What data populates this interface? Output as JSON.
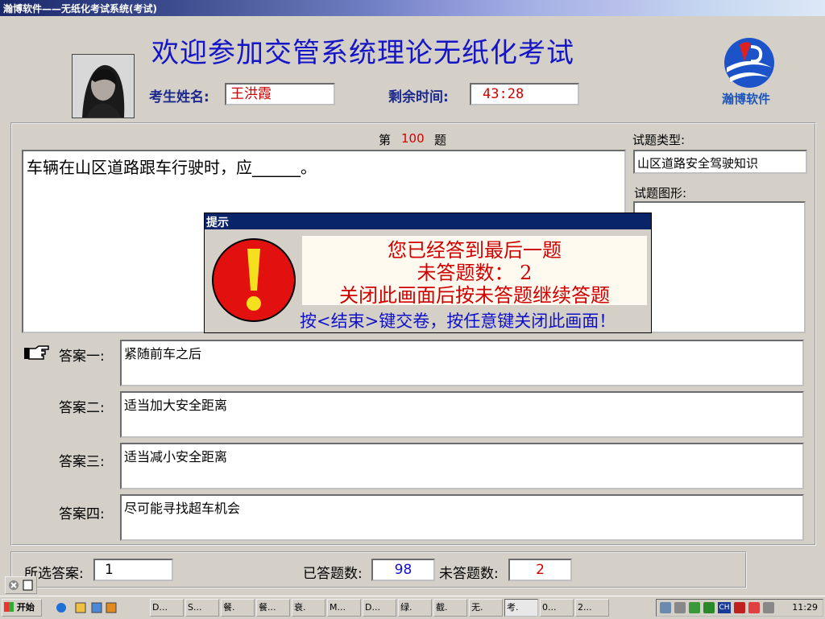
{
  "window": {
    "title": "瀚博软件——无纸化考试系统(考试)"
  },
  "header": {
    "main_title": "欢迎参加交管系统理论无纸化考试",
    "name_label": "考生姓名:",
    "name_value": "王洪霞",
    "time_label": "剩余时间:",
    "time_value": "43:28",
    "logo_text": "瀚博软件"
  },
  "question": {
    "num_prefix": "第",
    "num_value": "100",
    "num_suffix": "题",
    "text": "车辆在山区道路跟车行驶时，应______。",
    "type_label": "试题类型:",
    "type_value": "山区道路安全驾驶知识",
    "figure_label": "试题图形:"
  },
  "answers": [
    {
      "label": "答案一:",
      "text": "紧随前车之后"
    },
    {
      "label": "答案二:",
      "text": "适当加大安全距离"
    },
    {
      "label": "答案三:",
      "text": "适当减小安全距离"
    },
    {
      "label": "答案四:",
      "text": "尽可能寻找超车机会"
    }
  ],
  "dialog": {
    "title": "提示",
    "line1": "您已经答到最后一题",
    "line2": "未答题数：    2",
    "line3": "关闭此画面后按未答题继续答题",
    "hint": "按<结束>键交卷，按任意键关闭此画面！"
  },
  "stats": {
    "selected_label": "所选答案:",
    "selected_value": "1",
    "answered_label": "已答题数:",
    "answered_value": "98",
    "unanswered_label": "未答题数:",
    "unanswered_value": "2"
  },
  "taskbar": {
    "start": "开始",
    "buttons": [
      "D...",
      "S...",
      "餐.",
      "餐...",
      "衰.",
      "M...",
      "D...",
      "绿.",
      "截.",
      "无.",
      "考.",
      "0...",
      "2..."
    ],
    "tray_lang": "CH",
    "clock": "11:29"
  },
  "colors": {
    "title_blue": "#1515c8",
    "answer_red": "#d00000",
    "dialog_navy": "#0a246a"
  }
}
